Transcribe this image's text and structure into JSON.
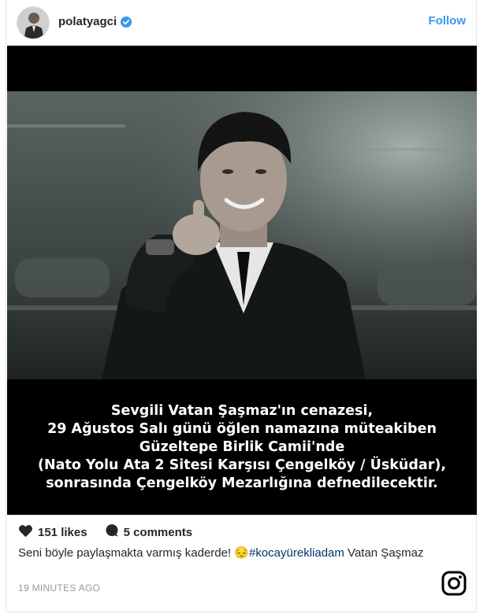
{
  "post": {
    "username": "polatyagci",
    "follow_label": "Follow",
    "photo_text_lines": [
      "Sevgili Vatan Şaşmaz'ın cenazesi,",
      "29 Ağustos Salı günü öğlen namazına müteakiben",
      "Güzeltepe Birlik Camii'nde",
      "(Nato Yolu Ata 2 Sitesi Karşısı Çengelköy / Üsküdar),",
      "sonrasında Çengelköy Mezarlığına defnedilecektir."
    ],
    "likes": "151 likes",
    "comments": "5 comments",
    "caption_text": "Seni böyle paylaşmakta varmış kaderde! 😔",
    "hashtag": "#kocayürekliadam",
    "caption_tail": " Vatan Şaşmaz",
    "time_ago": "19 MINUTES AGO"
  },
  "colors": {
    "accent": "#3897f0",
    "hashtag": "#003569",
    "muted": "#999999",
    "text": "#262626"
  },
  "icons": [
    "verified-badge-icon",
    "heart-icon",
    "comment-icon",
    "instagram-logo-icon"
  ]
}
